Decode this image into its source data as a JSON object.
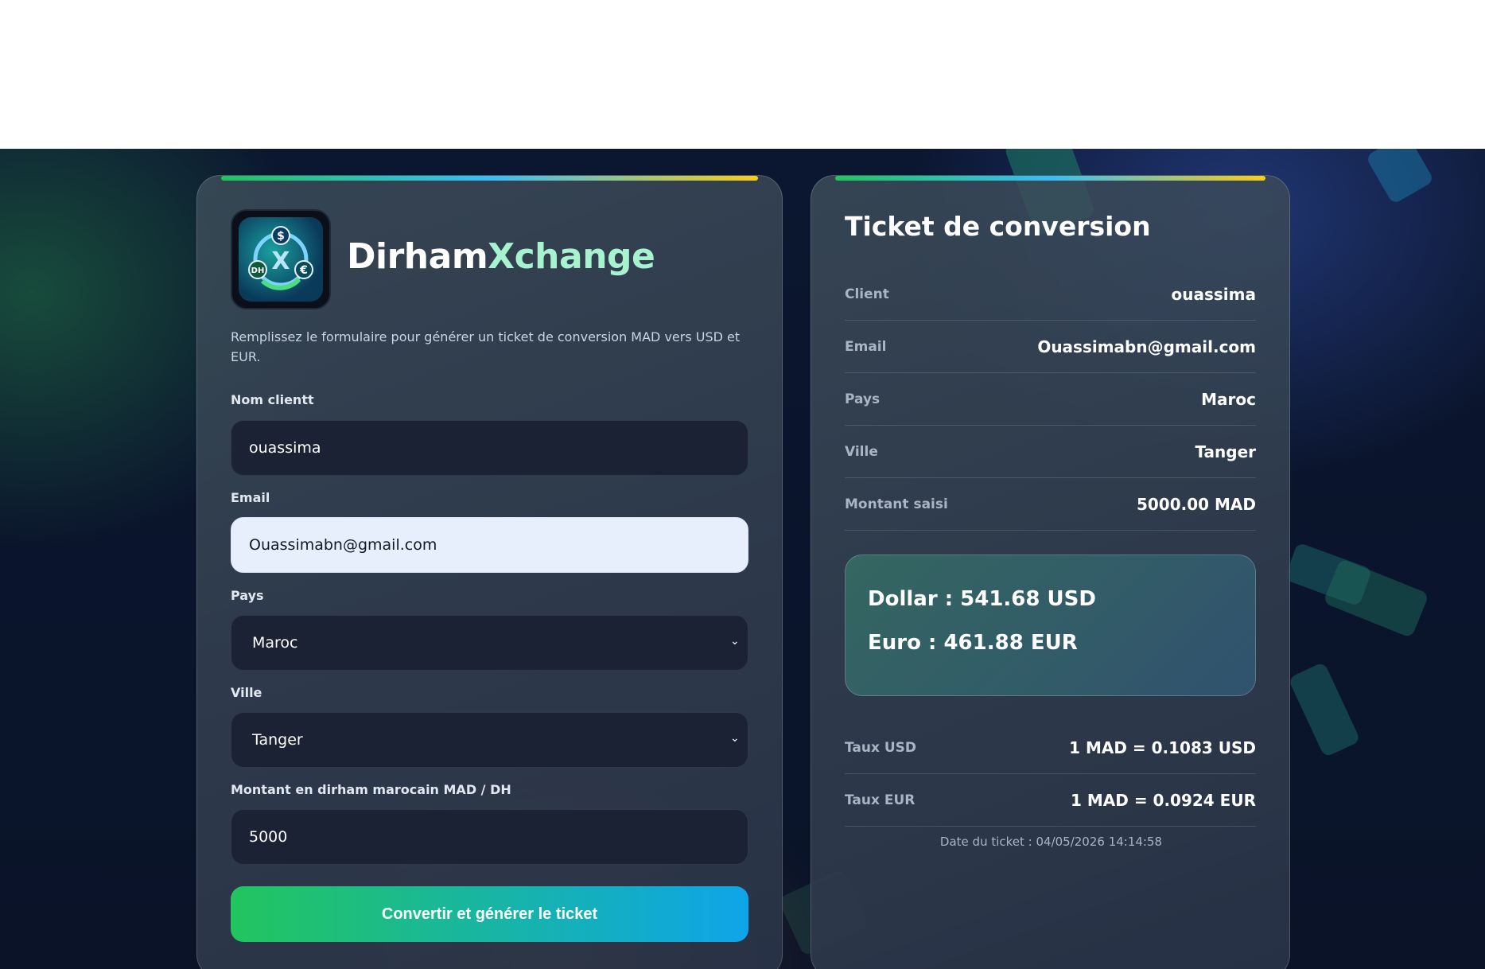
{
  "brand": {
    "name_part1": "Dirham",
    "name_part2": "Xchange"
  },
  "form": {
    "description": "Remplissez le formulaire pour générer un ticket de conversion MAD vers USD et EUR.",
    "name_label": "Nom clientt",
    "name_value": "ouassima",
    "email_label": "Email",
    "email_value": "Ouassimabn@gmail.com",
    "country_label": "Pays",
    "country_value": "Maroc",
    "city_label": "Ville",
    "city_value": "Tanger",
    "amount_label": "Montant en dirham marocain MAD / DH",
    "amount_value": "5000",
    "submit_label": "Convertir et générer le ticket"
  },
  "ticket": {
    "title": "Ticket de conversion",
    "rows": [
      {
        "key": "Client",
        "value": "ouassima"
      },
      {
        "key": "Email",
        "value": "Ouassimabn@gmail.com"
      },
      {
        "key": "Pays",
        "value": "Maroc"
      },
      {
        "key": "Ville",
        "value": "Tanger"
      },
      {
        "key": "Montant saisi",
        "value": "5000.00 MAD"
      }
    ],
    "dollar": "Dollar : 541.68 USD",
    "euro": "Euro : 461.88 EUR",
    "rates": [
      {
        "key": "Taux USD",
        "value": "1 MAD = 0.1083 USD"
      },
      {
        "key": "Taux EUR",
        "value": "1 MAD = 0.0924 EUR"
      }
    ],
    "date": "Date du ticket : 04/05/2026 14:14:58"
  },
  "colors": {
    "accent_green": "#22c55e",
    "accent_blue": "#0ea5e9",
    "accent_yellow": "#facc15",
    "brand_highlight": "#a7f3d0"
  },
  "icons": {
    "logo": "currency-exchange-icon",
    "select": "chevron-down-icon"
  }
}
